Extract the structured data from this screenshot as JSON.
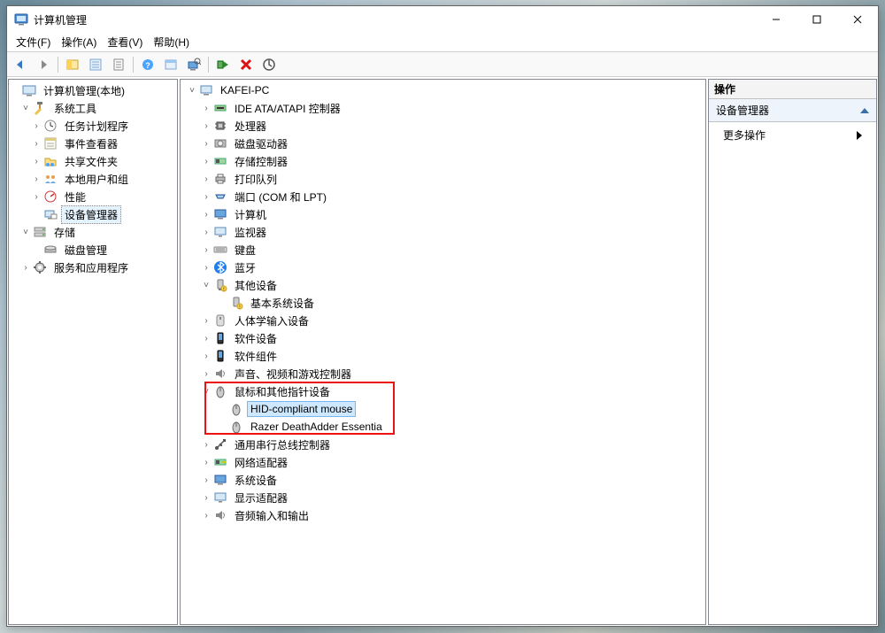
{
  "window": {
    "title": "计算机管理",
    "min": "–",
    "max": "□",
    "close": "×"
  },
  "menu": {
    "file": "文件(F)",
    "action": "操作(A)",
    "view": "查看(V)",
    "help": "帮助(H)"
  },
  "left_tree": {
    "root": "计算机管理(本地)",
    "systools": "系统工具",
    "task_scheduler": "任务计划程序",
    "event_viewer": "事件查看器",
    "shared_folders": "共享文件夹",
    "local_users": "本地用户和组",
    "performance": "性能",
    "device_manager": "设备管理器",
    "storage": "存储",
    "disk_mgmt": "磁盘管理",
    "services_apps": "服务和应用程序"
  },
  "mid_tree": {
    "pc": "KAFEI-PC",
    "ide": "IDE ATA/ATAPI 控制器",
    "cpu": "处理器",
    "disk_drives": "磁盘驱动器",
    "storage_ctrl": "存储控制器",
    "print_queues": "打印队列",
    "ports": "端口 (COM 和 LPT)",
    "computer": "计算机",
    "monitor": "监视器",
    "keyboard": "键盘",
    "bluetooth": "蓝牙",
    "other_devices": "其他设备",
    "base_sys_dev": "基本系统设备",
    "hid": "人体学输入设备",
    "soft_dev": "软件设备",
    "soft_comp": "软件组件",
    "sound": "声音、视频和游戏控制器",
    "mice": "鼠标和其他指针设备",
    "hid_mouse": "HID-compliant mouse",
    "razer_mouse": "Razer DeathAdder Essentia",
    "usb": "通用串行总线控制器",
    "network": "网络适配器",
    "sys_dev": "系统设备",
    "display": "显示适配器",
    "audio_io": "音频输入和输出"
  },
  "actions": {
    "header": "操作",
    "section": "设备管理器",
    "more": "更多操作"
  }
}
